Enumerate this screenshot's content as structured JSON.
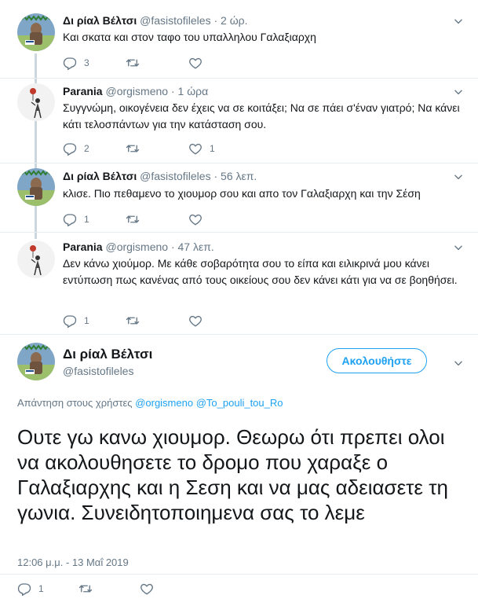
{
  "tweets": [
    {
      "name": "Δι ρίαλ Βέλτσι",
      "handle": "@fasistofileles",
      "sep": "·",
      "time": "2 ώρ.",
      "text": "Και σκατα και στον ταφο του υπαλληλου Γαλαξιαρχη",
      "replies": "3",
      "retweets": "",
      "likes": ""
    },
    {
      "name": "Parania",
      "handle": "@orgismeno",
      "sep": "·",
      "time": "1 ώρα",
      "text": "Συγγνώμη, οικογένεια δεν έχεις να σε κοιτάξει; Να σε πάει σ'έναν γιατρό; Να κάνει κάτι τελοσπάντων για την κατάσταση σου.",
      "replies": "2",
      "retweets": "",
      "likes": "1"
    },
    {
      "name": "Δι ρίαλ Βέλτσι",
      "handle": "@fasistofileles",
      "sep": "·",
      "time": "56 λεπ.",
      "text": "κλισε. Πιο πεθαμενο το χιουμορ σου και απο τον Γαλαξιαρχη και την Σέση",
      "replies": "1",
      "retweets": "",
      "likes": ""
    },
    {
      "name": "Parania",
      "handle": "@orgismeno",
      "sep": "·",
      "time": "47 λεπ.",
      "text": "Δεν κάνω χιούμορ. Με κάθε σοβαρότητα σου το είπα και ειλικρινά μου κάνει εντύπωση πως κανένας από τους οικείους σου δεν κάνει κάτι για να σε βοηθήσει.",
      "replies": "1",
      "retweets": "",
      "likes": ""
    }
  ],
  "main": {
    "name": "Δι ρίαλ Βέλτσι",
    "handle": "@fasistofileles",
    "follow_label": "Ακολουθήστε",
    "reply_prefix": "Απάντηση στους χρήστες",
    "reply_to_1": "@orgismeno",
    "reply_to_2": "@To_pouli_tou_Ro",
    "text": "Ουτε γω κανω χιουμορ. Θεωρω ότι πρεπει ολοι να ακολουθησετε το δρομο που χαραξε ο Γαλαξιαρχης και η Σεση και να μας αδειασετε τη γωνια. Συνειδητοποιημενα σας το λεμε",
    "timestamp": "12:06 μ.μ. - 13 Μαΐ 2019",
    "replies": "1",
    "retweets": "",
    "likes": ""
  },
  "colors": {
    "accent": "#1da1f2",
    "muted": "#657786",
    "thread_line": "#ccd6dd"
  },
  "icons": [
    "reply-icon",
    "retweet-icon",
    "like-icon",
    "chevron-down-icon",
    "avatar-statue",
    "avatar-figure"
  ]
}
